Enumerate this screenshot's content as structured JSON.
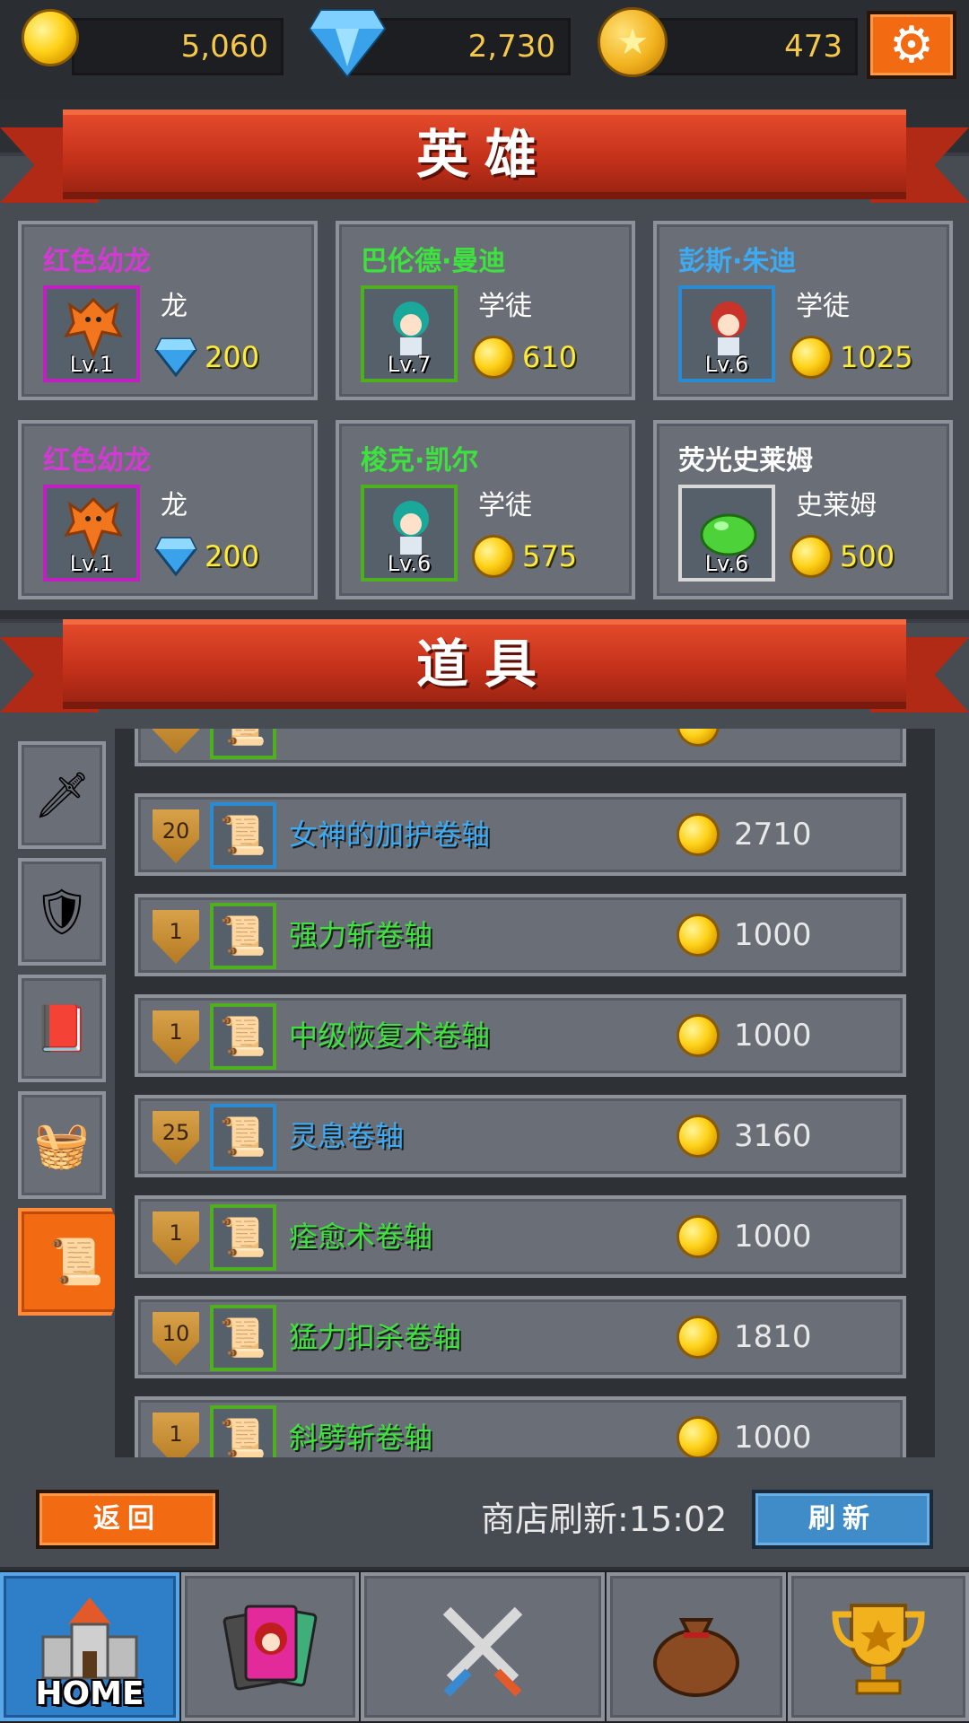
{
  "currency": {
    "gold": "5,060",
    "gems": "2,730",
    "stars": "473"
  },
  "hero_section": {
    "title": "英雄",
    "heroes": [
      {
        "name": "红色幼龙",
        "name_color": "#d33ad3",
        "level": "Lv.1",
        "class": "龙",
        "price": "200",
        "currency": "gem",
        "frame_color": "#c020c0",
        "icon": "dragon-icon"
      },
      {
        "name": "巴伦德·曼迪",
        "name_color": "#3ee23e",
        "level": "Lv.7",
        "class": "学徒",
        "price": "610",
        "currency": "gold",
        "frame_color": "#4eb01e",
        "icon": "apprentice-icon"
      },
      {
        "name": "彭斯·朱迪",
        "name_color": "#3eaaf2",
        "level": "Lv.6",
        "class": "学徒",
        "price": "1025",
        "currency": "gold",
        "frame_color": "#2a8ad2",
        "icon": "apprentice-icon"
      },
      {
        "name": "红色幼龙",
        "name_color": "#d33ad3",
        "level": "Lv.1",
        "class": "龙",
        "price": "200",
        "currency": "gem",
        "frame_color": "#c020c0",
        "icon": "dragon-icon"
      },
      {
        "name": "梭克·凯尔",
        "name_color": "#3ee23e",
        "level": "Lv.6",
        "class": "学徒",
        "price": "575",
        "currency": "gold",
        "frame_color": "#4eb01e",
        "icon": "apprentice-icon"
      },
      {
        "name": "荧光史莱姆",
        "name_color": "#ffffff",
        "level": "Lv.6",
        "class": "史莱姆",
        "price": "500",
        "currency": "gold",
        "frame_color": "#d8d8d8",
        "icon": "slime-icon"
      }
    ]
  },
  "item_section": {
    "title": "道具",
    "tabs": [
      {
        "name": "weapon",
        "icon": "sword-icon",
        "glyph": "🗡"
      },
      {
        "name": "armor",
        "icon": "shield-icon",
        "glyph": "🛡"
      },
      {
        "name": "book",
        "icon": "book-icon",
        "glyph": "📕"
      },
      {
        "name": "chest",
        "icon": "chest-icon",
        "glyph": "🧺"
      },
      {
        "name": "scroll",
        "icon": "scroll-icon",
        "glyph": "📜"
      }
    ],
    "active_tab": "scroll",
    "items": [
      {
        "level": "20",
        "name": "女神的加护卷轴",
        "name_color": "#3eaaf2",
        "frame_color": "#2a8ad2",
        "price": "2710"
      },
      {
        "level": "1",
        "name": "强力斩卷轴",
        "name_color": "#3ee23e",
        "frame_color": "#4eb01e",
        "price": "1000"
      },
      {
        "level": "1",
        "name": "中级恢复术卷轴",
        "name_color": "#3ee23e",
        "frame_color": "#4eb01e",
        "price": "1000"
      },
      {
        "level": "25",
        "name": "灵息卷轴",
        "name_color": "#3eaaf2",
        "frame_color": "#2a8ad2",
        "price": "3160"
      },
      {
        "level": "1",
        "name": "痊愈术卷轴",
        "name_color": "#3ee23e",
        "frame_color": "#4eb01e",
        "price": "1000"
      },
      {
        "level": "10",
        "name": "猛力扣杀卷轴",
        "name_color": "#3ee23e",
        "frame_color": "#4eb01e",
        "price": "1810"
      },
      {
        "level": "1",
        "name": "斜劈斩卷轴",
        "name_color": "#3ee23e",
        "frame_color": "#4eb01e",
        "price": "1000"
      }
    ]
  },
  "controls": {
    "back_label": "返回",
    "refresh_timer_label": "商店刷新:15:02",
    "refresh_label": "刷新"
  },
  "nav": {
    "home_label": "HOME",
    "items": [
      {
        "name": "home",
        "icon": "castle-icon"
      },
      {
        "name": "cards",
        "icon": "cards-icon"
      },
      {
        "name": "battle",
        "icon": "crossed-swords-icon"
      },
      {
        "name": "bag",
        "icon": "bag-icon"
      },
      {
        "name": "trophy",
        "icon": "trophy-icon"
      }
    ]
  }
}
